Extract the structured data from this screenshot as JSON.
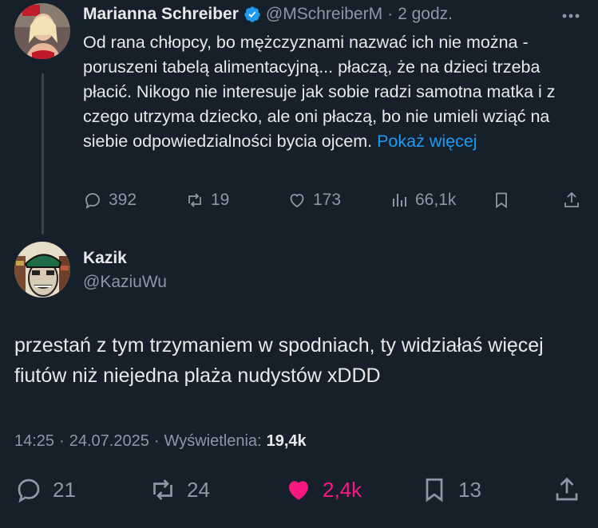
{
  "parent_tweet": {
    "author_name": "Marianna Schreiber",
    "handle": "@MSchreiberM",
    "separator": "·",
    "time": "2 godz.",
    "text": "Od rana chłopcy, bo mężczyznami nazwać ich nie można - poruszeni tabelą alimentacyjną... płaczą, że na dzieci trzeba płacić. Nikogo nie interesuje jak sobie radzi samotna matka i z czego utrzyma dziecko, ale oni płaczą, bo nie umieli wziąć na siebie odpowiedzialności bycia ojcem.",
    "show_more": "Pokaż więcej",
    "actions": {
      "replies": "392",
      "reposts": "19",
      "likes": "173",
      "views": "66,1k"
    }
  },
  "reply_tweet": {
    "author_name": "Kazik",
    "handle": "@KaziuWu",
    "text": "przestań z tym trzymaniem w spodniach, ty widziałaś więcej fiutów niż niejedna plaża nudystów xDDD",
    "time": "14:25",
    "dot": "·",
    "date": "24.07.2025",
    "views_label": "Wyświetlenia:",
    "views": "19,4k",
    "actions": {
      "replies": "21",
      "reposts": "24",
      "likes": "2,4k",
      "bookmarks": "13"
    }
  },
  "colors": {
    "background": "#15202b",
    "accent": "#1d9bf0",
    "like_active": "#f91880",
    "muted": "#8b98a5",
    "verified": "#1d9bf0"
  }
}
